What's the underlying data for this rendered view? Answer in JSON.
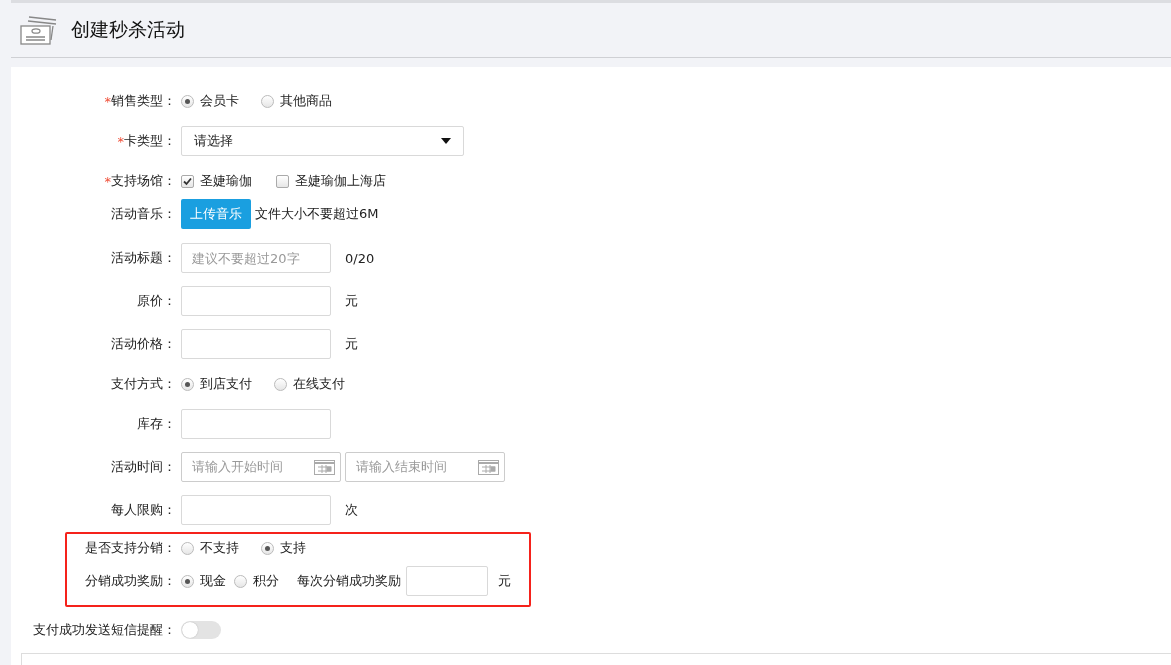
{
  "header": {
    "title": "创建秒杀活动"
  },
  "fields": [
    {
      "kind": "radio",
      "required_mark": "*",
      "label": "销售类型：",
      "options": [
        {
          "label": "会员卡",
          "selected": true
        },
        {
          "label": "其他商品",
          "selected": false
        }
      ]
    },
    {
      "kind": "select",
      "required_mark": "*",
      "label": "卡类型：",
      "value": "请选择"
    },
    {
      "kind": "checkbox",
      "required_mark": "*",
      "label": "支持场馆：",
      "options": [
        {
          "label": "圣婕瑜伽",
          "checked": true
        },
        {
          "label": "圣婕瑜伽上海店",
          "checked": false
        }
      ]
    },
    {
      "kind": "upload",
      "label": "活动音乐：",
      "button": "上传音乐",
      "hint": "文件大小不要超过6M"
    },
    {
      "kind": "input",
      "label": "活动标题：",
      "placeholder": "建议不要超过20字",
      "suffix": "0/20"
    },
    {
      "kind": "input",
      "label": "原价：",
      "suffix": "元"
    },
    {
      "kind": "input",
      "label": "活动价格：",
      "suffix": "元"
    },
    {
      "kind": "radio",
      "label": "支付方式：",
      "options": [
        {
          "label": "到店支付",
          "selected": true
        },
        {
          "label": "在线支付",
          "selected": false
        }
      ]
    },
    {
      "kind": "input",
      "label": "库存："
    },
    {
      "kind": "date-range",
      "label": "活动时间：",
      "start_placeholder": "请输入开始时间",
      "end_placeholder": "请输入结束时间"
    },
    {
      "kind": "input",
      "label": "每人限购：",
      "suffix": "次"
    }
  ],
  "highlight_box": {
    "fields": [
      {
        "kind": "radio",
        "label": "是否支持分销：",
        "options": [
          {
            "label": "不支持",
            "selected": false
          },
          {
            "label": "支持",
            "selected": true
          }
        ]
      },
      {
        "kind": "radio-input",
        "label": "分销成功奖励：",
        "options": [
          {
            "label": "现金",
            "selected": true
          },
          {
            "label": "积分",
            "selected": false
          }
        ],
        "extra_label": "每次分销成功奖励",
        "suffix": "元"
      }
    ]
  },
  "sms_reminder": {
    "label": "支付成功发送短信提醒：",
    "on": false
  }
}
